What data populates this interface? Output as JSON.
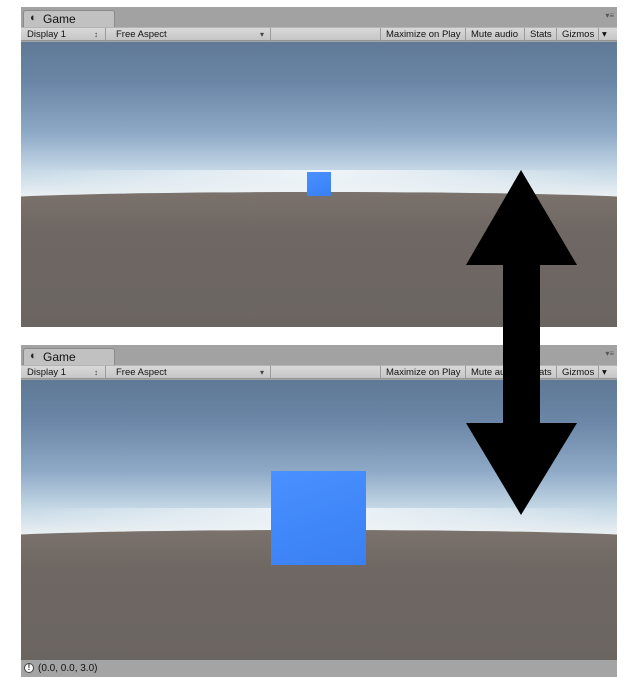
{
  "panels": [
    {
      "tab_label": "Game",
      "tab_icon": "unity-game-icon",
      "display_dropdown": "Display 1",
      "display_dropdown_arrow": "↕",
      "aspect_dropdown": "Free Aspect",
      "aspect_dropdown_arrow": "▾",
      "maximize_label": "Maximize on Play",
      "mute_label": "Mute audio",
      "stats_label": "Stats",
      "gizmos_label": "Gizmos",
      "gizmos_arrow": "▾",
      "panel_menu_glyph": "▾≡",
      "cube_view": "far"
    },
    {
      "tab_label": "Game",
      "tab_icon": "unity-game-icon",
      "display_dropdown": "Display 1",
      "display_dropdown_arrow": "↕",
      "aspect_dropdown": "Free Aspect",
      "aspect_dropdown_arrow": "▾",
      "maximize_label": "Maximize on Play",
      "mute_label": "Mute audio",
      "stats_label": "Stats",
      "gizmos_label": "Gizmos",
      "gizmos_arrow": "▾",
      "panel_menu_glyph": "▾≡",
      "cube_view": "near"
    }
  ],
  "status": {
    "icon": "info-icon",
    "text": "(0.0, 0.0, 3.0)"
  },
  "overlay": {
    "icon": "double-headed-vertical-arrow"
  },
  "colors": {
    "cube": "#3f86f8",
    "arrow": "#000000",
    "panel_bg": "#a4a4a4"
  }
}
